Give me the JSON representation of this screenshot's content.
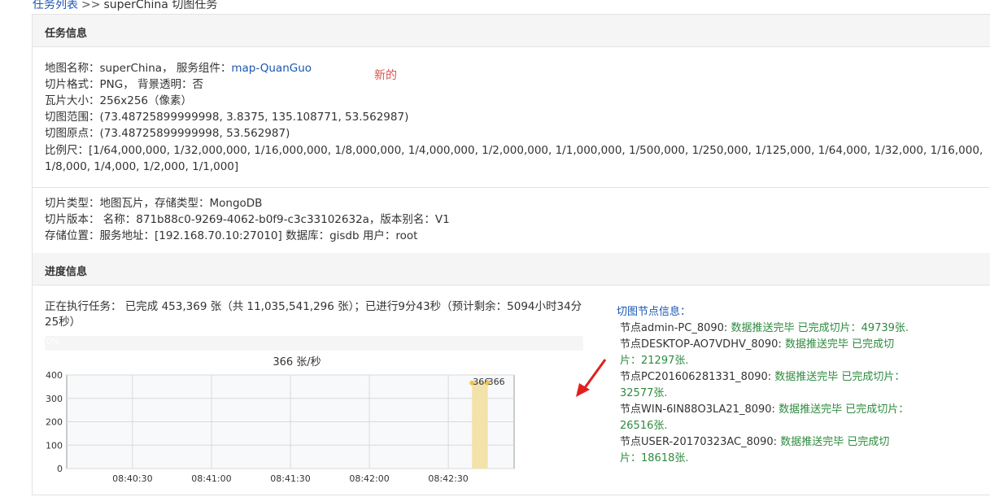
{
  "breadcrumb": {
    "link": "任务列表",
    "separator": ">>",
    "current": "superChina 切图任务"
  },
  "task_info": {
    "heading": "任务信息",
    "map_line": "地图名称：superChina， 服务组件：",
    "service_link": "map-QuanGuo",
    "new_mark": "新的",
    "format": "切片格式：PNG， 背景透明：否",
    "tile_size": "瓦片大小：256x256（像素）",
    "extent": "切图范围：(73.48725899999998, 3.8375, 135.108771, 53.562987)",
    "origin": "切图原点：(73.48725899999998, 53.562987)",
    "scales": "比例尺：[1/64,000,000, 1/32,000,000, 1/16,000,000, 1/8,000,000, 1/4,000,000, 1/2,000,000, 1/1,000,000, 1/500,000, 1/250,000, 1/125,000, 1/64,000, 1/32,000, 1/16,000, 1/8,000, 1/4,000, 1/2,000, 1/1,000]",
    "type": "切片类型：地图瓦片，存储类型：MongoDB",
    "version": "切片版本： 名称：871b88c0-9269-4062-b0f9-c3c33102632a，版本别名：V1",
    "storage": "存储位置：服务地址：[192.168.70.10:27010]  数据库：gisdb  用户：root"
  },
  "progress": {
    "heading": "进度信息",
    "text": "正在执行任务： 已完成 453,369 张（共 11,035,541,296 张）；已进行9分43秒（预计剩余：5094小时34分25秒）",
    "percent_label": "0%",
    "fraction": 0.0
  },
  "chart_data": {
    "type": "area",
    "title": "366 张/秒",
    "x": [
      "08:40:30",
      "08:41:00",
      "08:41:30",
      "08:42:00",
      "08:42:30"
    ],
    "ylim": [
      0,
      400
    ],
    "yticks": [
      "0",
      "100",
      "200",
      "300",
      "400"
    ],
    "grid": true,
    "series": [
      {
        "points": [
          {
            "x": "08:42:39",
            "y": 366,
            "label": "366"
          },
          {
            "x": "08:42:45",
            "y": 366,
            "label": "366"
          }
        ]
      }
    ],
    "colors": {
      "fill": "#f3e2a9",
      "point": "#f0c44c",
      "line": "#d0b060"
    }
  },
  "nodes": {
    "title": "切图节点信息：",
    "items": [
      {
        "name": "节点admin-PC_8090:",
        "status": "数据推送完毕  已完成切片：49739张."
      },
      {
        "name": "节点DESKTOP-AO7VDHV_8090:",
        "status": "数据推送完毕  已完成切片：21297张."
      },
      {
        "name": "节点PC201606281331_8090:",
        "status": "数据推送完毕  已完成切片：32577张."
      },
      {
        "name": "节点WIN-6IN88O3LA21_8090:",
        "status": "数据推送完毕  已完成切片：26516张."
      },
      {
        "name": "节点USER-20170323AC_8090:",
        "status": "数据推送完毕  已完成切片：18618张."
      }
    ]
  },
  "colors": {
    "link": "#1a56b0",
    "success": "#2e8b3e",
    "alert": "#d9534f",
    "arrow": "#e0201e"
  }
}
